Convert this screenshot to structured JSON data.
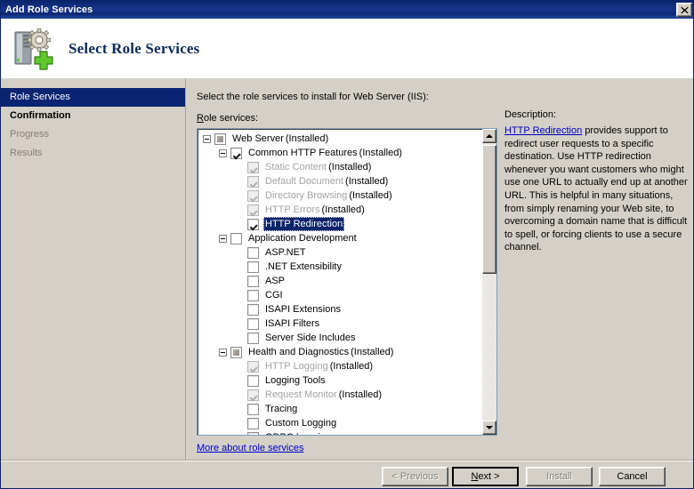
{
  "window": {
    "title": "Add Role Services",
    "close_label": "✕"
  },
  "header": {
    "title": "Select Role Services",
    "icon": "server-gear-add-icon"
  },
  "sidebar": {
    "items": [
      {
        "label": "Role Services",
        "state": "current"
      },
      {
        "label": "Confirmation",
        "state": "done"
      },
      {
        "label": "Progress",
        "state": "disabled"
      },
      {
        "label": "Results",
        "state": "disabled"
      }
    ]
  },
  "main": {
    "intro": "Select the role services to install for Web Server (IIS):",
    "roleservices_label_accel": "R",
    "roleservices_label_rest": "ole services:",
    "more_link": "More about role services"
  },
  "tree": {
    "rows": [
      {
        "level": 0,
        "expander": "minus",
        "checkbox": "partial",
        "label": "Web Server",
        "suffix": "(Installed)",
        "dim": false,
        "selected": false
      },
      {
        "level": 1,
        "expander": "minus",
        "checkbox": "checked",
        "label": "Common HTTP Features",
        "suffix": "(Installed)",
        "dim": false,
        "selected": false
      },
      {
        "level": 2,
        "expander": "none",
        "checkbox": "installed",
        "label": "Static Content",
        "suffix": "(Installed)",
        "dim": true,
        "selected": false
      },
      {
        "level": 2,
        "expander": "none",
        "checkbox": "installed",
        "label": "Default Document",
        "suffix": "(Installed)",
        "dim": true,
        "selected": false
      },
      {
        "level": 2,
        "expander": "none",
        "checkbox": "installed",
        "label": "Directory Browsing",
        "suffix": "(Installed)",
        "dim": true,
        "selected": false
      },
      {
        "level": 2,
        "expander": "none",
        "checkbox": "installed",
        "label": "HTTP Errors",
        "suffix": "(Installed)",
        "dim": true,
        "selected": false
      },
      {
        "level": 2,
        "expander": "none",
        "checkbox": "checked",
        "label": "HTTP Redirection",
        "suffix": "",
        "dim": false,
        "selected": true
      },
      {
        "level": 1,
        "expander": "minus",
        "checkbox": "unchecked",
        "label": "Application Development",
        "suffix": "",
        "dim": false,
        "selected": false
      },
      {
        "level": 2,
        "expander": "none",
        "checkbox": "unchecked",
        "label": "ASP.NET",
        "suffix": "",
        "dim": false,
        "selected": false
      },
      {
        "level": 2,
        "expander": "none",
        "checkbox": "unchecked",
        "label": ".NET Extensibility",
        "suffix": "",
        "dim": false,
        "selected": false
      },
      {
        "level": 2,
        "expander": "none",
        "checkbox": "unchecked",
        "label": "ASP",
        "suffix": "",
        "dim": false,
        "selected": false
      },
      {
        "level": 2,
        "expander": "none",
        "checkbox": "unchecked",
        "label": "CGI",
        "suffix": "",
        "dim": false,
        "selected": false
      },
      {
        "level": 2,
        "expander": "none",
        "checkbox": "unchecked",
        "label": "ISAPI Extensions",
        "suffix": "",
        "dim": false,
        "selected": false
      },
      {
        "level": 2,
        "expander": "none",
        "checkbox": "unchecked",
        "label": "ISAPI Filters",
        "suffix": "",
        "dim": false,
        "selected": false
      },
      {
        "level": 2,
        "expander": "none",
        "checkbox": "unchecked",
        "label": "Server Side Includes",
        "suffix": "",
        "dim": false,
        "selected": false
      },
      {
        "level": 1,
        "expander": "minus",
        "checkbox": "partial",
        "label": "Health and Diagnostics",
        "suffix": "(Installed)",
        "dim": false,
        "selected": false
      },
      {
        "level": 2,
        "expander": "none",
        "checkbox": "installed",
        "label": "HTTP Logging",
        "suffix": "(Installed)",
        "dim": true,
        "selected": false
      },
      {
        "level": 2,
        "expander": "none",
        "checkbox": "unchecked",
        "label": "Logging Tools",
        "suffix": "",
        "dim": false,
        "selected": false
      },
      {
        "level": 2,
        "expander": "none",
        "checkbox": "installed",
        "label": "Request Monitor",
        "suffix": "(Installed)",
        "dim": true,
        "selected": false
      },
      {
        "level": 2,
        "expander": "none",
        "checkbox": "unchecked",
        "label": "Tracing",
        "suffix": "",
        "dim": false,
        "selected": false
      },
      {
        "level": 2,
        "expander": "none",
        "checkbox": "unchecked",
        "label": "Custom Logging",
        "suffix": "",
        "dim": false,
        "selected": false
      },
      {
        "level": 2,
        "expander": "none",
        "checkbox": "unchecked",
        "label": "ODBC Logging",
        "suffix": "",
        "dim": false,
        "selected": false
      }
    ],
    "scrollbar": {
      "thumb_fraction": 0.47,
      "up_arrow": "scroll-up-arrow",
      "down_arrow": "scroll-down-arrow"
    }
  },
  "description": {
    "label": "Description:",
    "link_text": "HTTP Redirection",
    "body": " provides support to redirect user requests to a specific destination. Use HTTP redirection whenever you want customers who might use one URL to actually end up at another URL. This is helpful in many situations, from simply renaming your Web site, to overcoming a domain name that is difficult to spell, or forcing clients to use a secure channel."
  },
  "footer": {
    "buttons": [
      {
        "id": "previous",
        "label": "< Previous",
        "accel": "P",
        "state": "disabled"
      },
      {
        "id": "next",
        "label": "Next >",
        "accel": "N",
        "state": "default"
      },
      {
        "id": "install",
        "label": "Install",
        "accel": "I",
        "state": "disabled"
      },
      {
        "id": "cancel",
        "label": "Cancel",
        "accel": "",
        "state": "normal"
      }
    ]
  },
  "colors": {
    "titlebar": "#0a246a",
    "selection": "#0a246a",
    "dialog_face": "#d4d0c8",
    "link": "#0000cc",
    "header_title": "#0b2a59"
  }
}
